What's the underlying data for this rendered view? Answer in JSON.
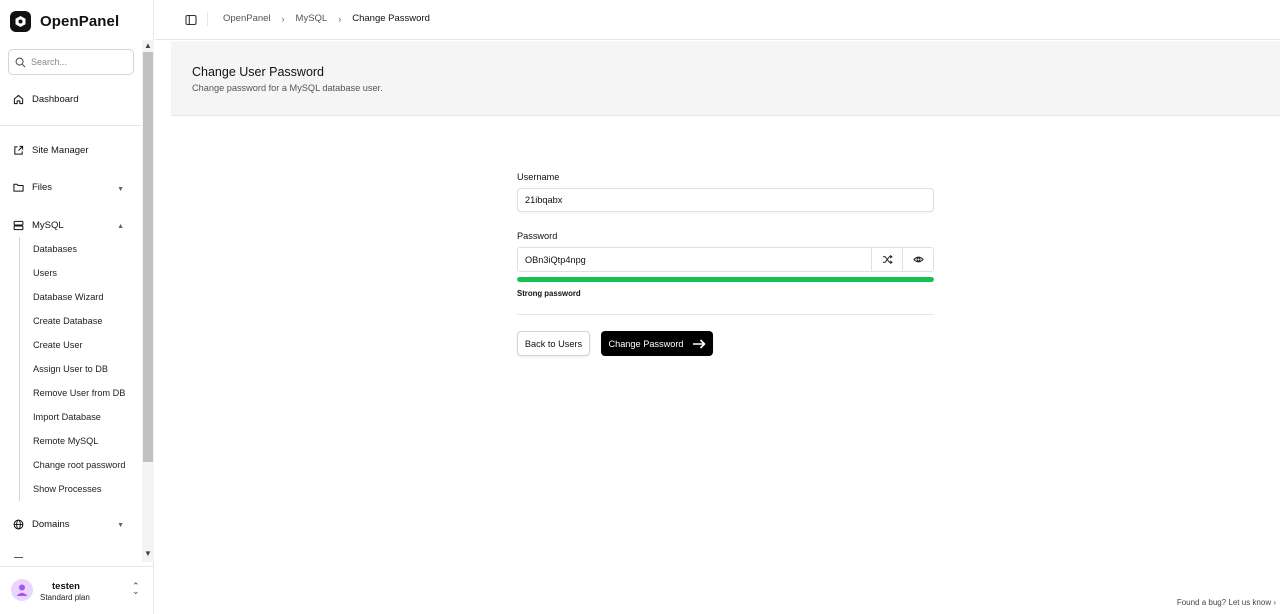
{
  "app": {
    "name": "OpenPanel"
  },
  "search": {
    "placeholder": "Search..."
  },
  "sidebar": {
    "dashboard": "Dashboard",
    "site_manager": "Site Manager",
    "files": "Files",
    "mysql": "MySQL",
    "mysql_items": [
      "Databases",
      "Users",
      "Database Wizard",
      "Create Database",
      "Create User",
      "Assign User to DB",
      "Remove User from DB",
      "Import Database",
      "Remote MySQL",
      "Change root password",
      "Show Processes"
    ],
    "domains": "Domains"
  },
  "user": {
    "name": "testen",
    "plan": "Standard plan"
  },
  "breadcrumb": {
    "root": "OpenPanel",
    "section": "MySQL",
    "current": "Change Password"
  },
  "header": {
    "title": "Change User Password",
    "subtitle": "Change password for a MySQL database user."
  },
  "form": {
    "username_label": "Username",
    "username_value": "21ibqabx",
    "password_label": "Password",
    "password_value": "OBn3iQtp4npg",
    "strength_text": "Strong password",
    "strength_level": 1.0,
    "strength_color": "#16c152",
    "back_button": "Back to Users",
    "submit_button": "Change Password"
  },
  "footer": {
    "bug_link": "Found a bug? Let us know"
  }
}
